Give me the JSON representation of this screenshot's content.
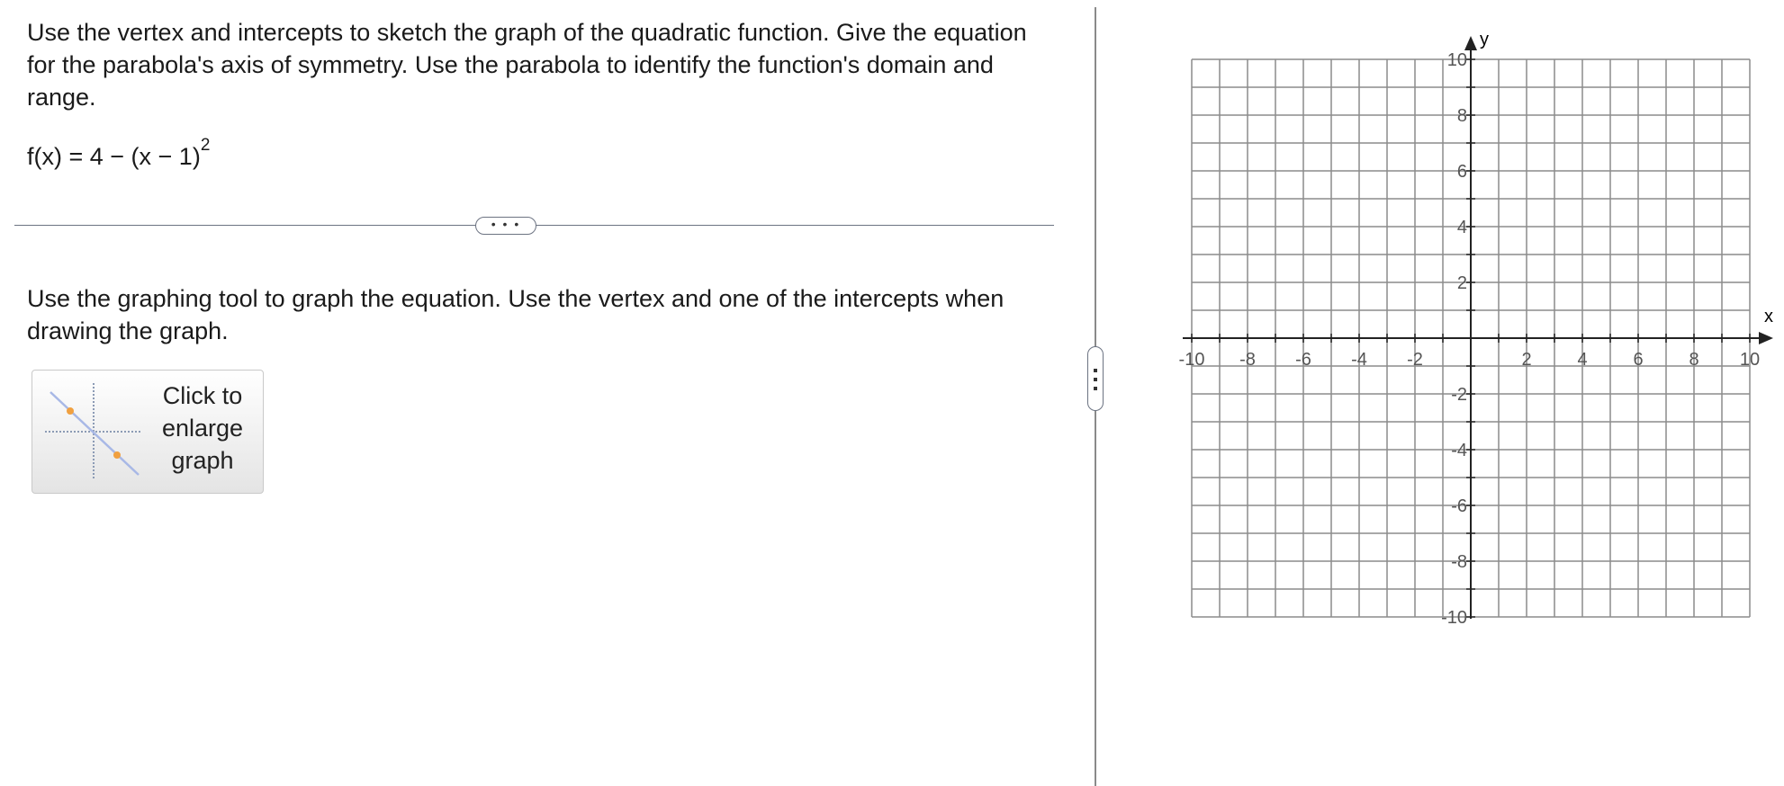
{
  "problem": {
    "instructions": "Use the vertex and intercepts to sketch the graph of the quadratic function. Give the equation for the parabola's axis of symmetry.  Use the parabola to identify the function's domain and range.",
    "equation_main": "f(x) = 4 − (x − 1)",
    "equation_exponent": "2"
  },
  "divider": {
    "expand_label": "• • •"
  },
  "graphing": {
    "instructions": "Use the graphing tool to graph the equation.  Use the vertex and one of the intercepts when drawing the graph.",
    "enlarge_button_lines": [
      "Click to",
      "enlarge",
      "graph"
    ]
  },
  "graph": {
    "x_axis_label": "x",
    "y_axis_label": "y",
    "x_range": [
      -10,
      10
    ],
    "y_range": [
      -10,
      10
    ],
    "grid_step": 1,
    "label_step": 2,
    "x_tick_labels": [
      "-10",
      "-8",
      "-6",
      "-4",
      "-2",
      "2",
      "4",
      "6",
      "8",
      "10"
    ],
    "y_tick_labels": [
      "10",
      "8",
      "6",
      "4",
      "2",
      "-2",
      "-4",
      "-6",
      "-8",
      "-10"
    ],
    "grid_color": "#8c8c8c",
    "axis_color": "#222222"
  },
  "thumbnail": {
    "line_color": "#a8b8e6",
    "point_color": "#f0a040"
  }
}
